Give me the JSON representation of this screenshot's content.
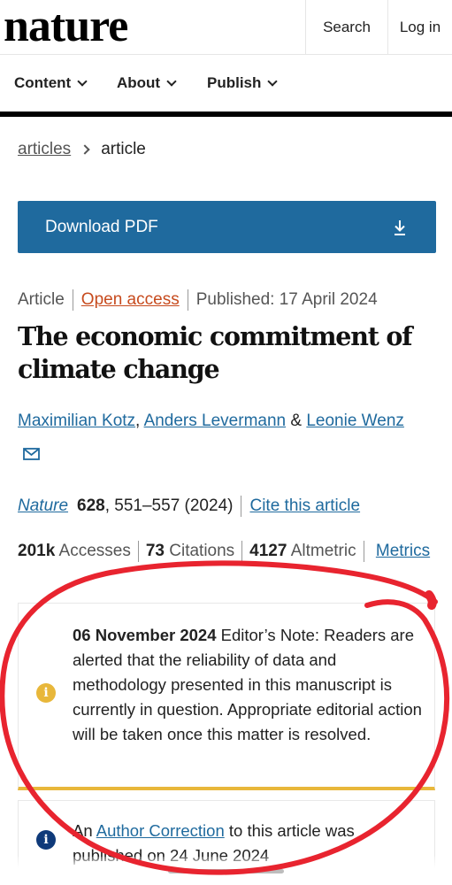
{
  "header": {
    "logo": "nature",
    "search_label": "Search",
    "login_label": "Log in"
  },
  "nav": {
    "items": [
      {
        "label": "Content"
      },
      {
        "label": "About"
      },
      {
        "label": "Publish"
      }
    ]
  },
  "breadcrumb": {
    "parent": "articles",
    "current": "article"
  },
  "download": {
    "label": "Download PDF",
    "icon": "download-icon"
  },
  "article": {
    "type": "Article",
    "access": "Open access",
    "published": "Published: 17 April 2024",
    "title": "The economic commitment of climate change",
    "authors": [
      {
        "name": "Maximilian Kotz"
      },
      {
        "name": "Anders Levermann"
      },
      {
        "name": "Leonie Wenz"
      }
    ],
    "author_sep": ", ",
    "author_and": " & ",
    "journal": "Nature",
    "volume": "628",
    "pages_year": ", 551–557 (2024)",
    "cite_label": "Cite this article"
  },
  "metrics": {
    "accesses_value": "201k",
    "accesses_label": "Accesses",
    "citations_value": "73",
    "citations_label": "Citations",
    "altmetric_value": "4127",
    "altmetric_label": "Altmetric",
    "metrics_link": "Metrics"
  },
  "editor_note": {
    "date": "06 November 2024",
    "text": " Editor’s Note: Readers are alerted that the reliability of data and methodology presented in this manuscript is currently in question. Appropriate editorial action will be taken once this matter is resolved.",
    "icon": "info-icon",
    "accent": "#e8b73a"
  },
  "correction": {
    "prefix": "An ",
    "link": "Author Correction",
    "suffix": " to this article was published on 24 June 2024",
    "icon": "info-icon"
  },
  "colors": {
    "link": "#1f6a9e",
    "open_access": "#c74b1e",
    "download_bg": "#1f6a9e",
    "annotation": "#e8242f"
  }
}
